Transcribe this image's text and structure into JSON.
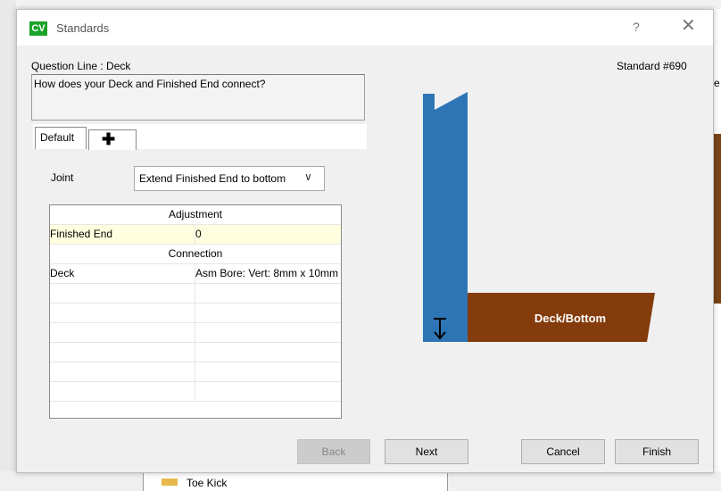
{
  "background": {
    "tree_item": "Toe Kick",
    "right_partial": "e"
  },
  "dialog": {
    "icon_text": "CV",
    "title": "Standards",
    "help": "?",
    "close": "✕"
  },
  "question": {
    "line_label": "Question Line : Deck",
    "standard": "Standard #690",
    "text": "How does your Deck and Finished End connect?"
  },
  "tabs": {
    "default_label": "Default",
    "add_label": "✚"
  },
  "joint": {
    "label": "Joint",
    "selected": "Extend Finished End to bottom",
    "chevron": "∨"
  },
  "grid": {
    "adjustment_header": "Adjustment",
    "connection_header": "Connection",
    "rows": [
      {
        "name": "Finished End",
        "value": "0"
      },
      {
        "name": "Deck",
        "value": "Asm Bore: Vert: 8mm x 10mm"
      }
    ]
  },
  "drawing": {
    "deck_label": "Deck/Bottom",
    "colors": {
      "finished_end": "#2e75b6",
      "deck": "#843c0c"
    }
  },
  "buttons": {
    "back": "Back",
    "next": "Next",
    "cancel": "Cancel",
    "finish": "Finish"
  }
}
